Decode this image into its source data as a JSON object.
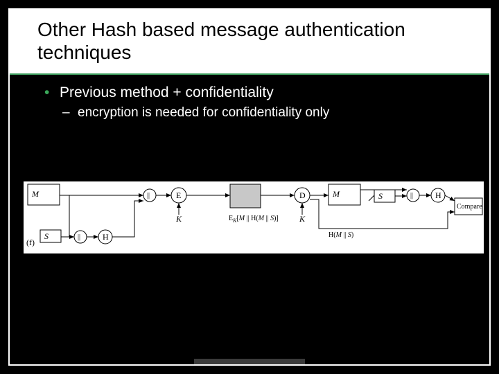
{
  "title": "Other Hash based message authentication techniques",
  "bullets": {
    "l1": "Previous method + confidentiality",
    "l2": "encryption is needed for confidentiality only"
  },
  "diagram": {
    "label_f": "(f)",
    "box_M1": "M",
    "box_S1": "S",
    "cat1": "||",
    "circ_H1": "H",
    "cat2": "||",
    "circ_E": "E",
    "key1": "K",
    "cipher": "E_K[M || H(M || S)]",
    "circ_D": "D",
    "key2": "K",
    "box_M2": "M",
    "box_S2": "S",
    "cat3": "||",
    "circ_H2": "H",
    "hash_out": "H(M || S)",
    "compare": "Compare"
  }
}
